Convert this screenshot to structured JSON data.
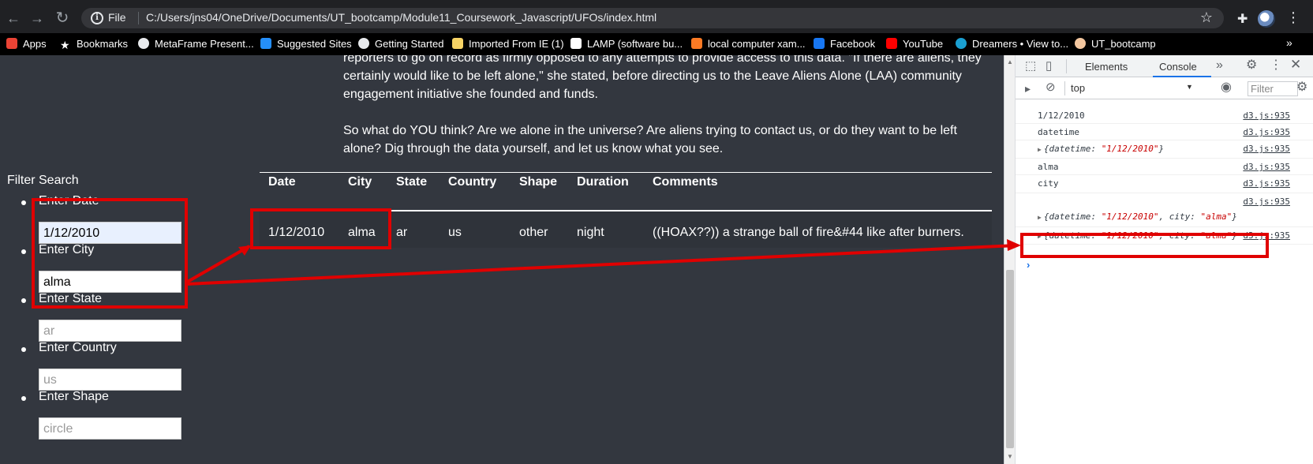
{
  "browser": {
    "url_scheme_label": "File",
    "url": "C:/Users/jns04/OneDrive/Documents/UT_bootcamp/Module11_Coursework_Javascript/UFOs/index.html",
    "bookmarks": [
      {
        "label": "Apps",
        "icon": "apps-grid-icon",
        "color": "#ea4335"
      },
      {
        "label": "Bookmarks",
        "icon": "star-icon",
        "color": "#ffffff"
      },
      {
        "label": "MetaFrame Present...",
        "icon": "globe-icon",
        "color": "#e8eaed"
      },
      {
        "label": "Suggested Sites",
        "icon": "bing-icon",
        "color": "#258ffa"
      },
      {
        "label": "Getting Started",
        "icon": "globe-icon",
        "color": "#e8eaed"
      },
      {
        "label": "Imported From IE (1)",
        "icon": "folder-icon",
        "color": "#f6d365"
      },
      {
        "label": "LAMP (software bu...",
        "icon": "wikipedia-icon",
        "color": "#ffffff"
      },
      {
        "label": "local computer xam...",
        "icon": "xampp-icon",
        "color": "#fb7a24"
      },
      {
        "label": "Facebook",
        "icon": "facebook-icon",
        "color": "#1877f2"
      },
      {
        "label": "YouTube",
        "icon": "youtube-icon",
        "color": "#ff0000"
      },
      {
        "label": "Dreamers • View to...",
        "icon": "dot-icon",
        "color": "#1a9fd1"
      },
      {
        "label": "UT_bootcamp",
        "icon": "ut-icon",
        "color": "#f4c7a0"
      }
    ]
  },
  "article": {
    "paragraph1_line1": "reporters to go on record as firmly opposed to any attempts to provide access to this data. \"If there are aliens, they",
    "paragraph1_line2": "certainly would like to be left alone,\" she stated, before directing us to the Leave Aliens Alone (LAA) community",
    "paragraph1_line3": "engagement initiative she founded and funds.",
    "paragraph2_line1": "So what do YOU think? Are we alone in the universe? Are aliens trying to contact us, or do they want to be left",
    "paragraph2_line2": "alone? Dig through the data yourself, and let us know what you see."
  },
  "filters": {
    "title": "Filter Search",
    "items": [
      {
        "label": "Enter Date",
        "value": "1/12/2010",
        "placeholder": ""
      },
      {
        "label": "Enter City",
        "value": "alma",
        "placeholder": ""
      },
      {
        "label": "Enter State",
        "value": "",
        "placeholder": "ar"
      },
      {
        "label": "Enter Country",
        "value": "",
        "placeholder": "us"
      },
      {
        "label": "Enter Shape",
        "value": "",
        "placeholder": "circle"
      }
    ]
  },
  "table": {
    "headers": [
      "Date",
      "City",
      "State",
      "Country",
      "Shape",
      "Duration",
      "Comments"
    ],
    "rows": [
      [
        "1/12/2010",
        "alma",
        "ar",
        "us",
        "other",
        "night",
        "((HOAX??)) a strange ball of fire&#44 like after burners."
      ]
    ]
  },
  "devtools": {
    "tabs": [
      "Elements",
      "Console"
    ],
    "active_tab": "Console",
    "context": "top",
    "filter_placeholder": "Filter",
    "source": "d3.js:935",
    "logs": [
      {
        "type": "text",
        "text": "1/12/2010"
      },
      {
        "type": "text",
        "text": "datetime"
      },
      {
        "type": "object",
        "entries": [
          {
            "key": "datetime",
            "value": "\"1/12/2010\""
          }
        ]
      },
      {
        "type": "text",
        "text": "alma"
      },
      {
        "type": "text",
        "text": "city"
      },
      {
        "type": "object",
        "entries": [
          {
            "key": "datetime",
            "value": "\"1/12/2010\""
          },
          {
            "key": "city",
            "value": "\"alma\""
          }
        ]
      },
      {
        "type": "object",
        "entries": [
          {
            "key": "datetime",
            "value": "\"1/12/2010\""
          },
          {
            "key": "city",
            "value": "\"alma\""
          }
        ]
      }
    ]
  },
  "annotation_color": "#e00000"
}
